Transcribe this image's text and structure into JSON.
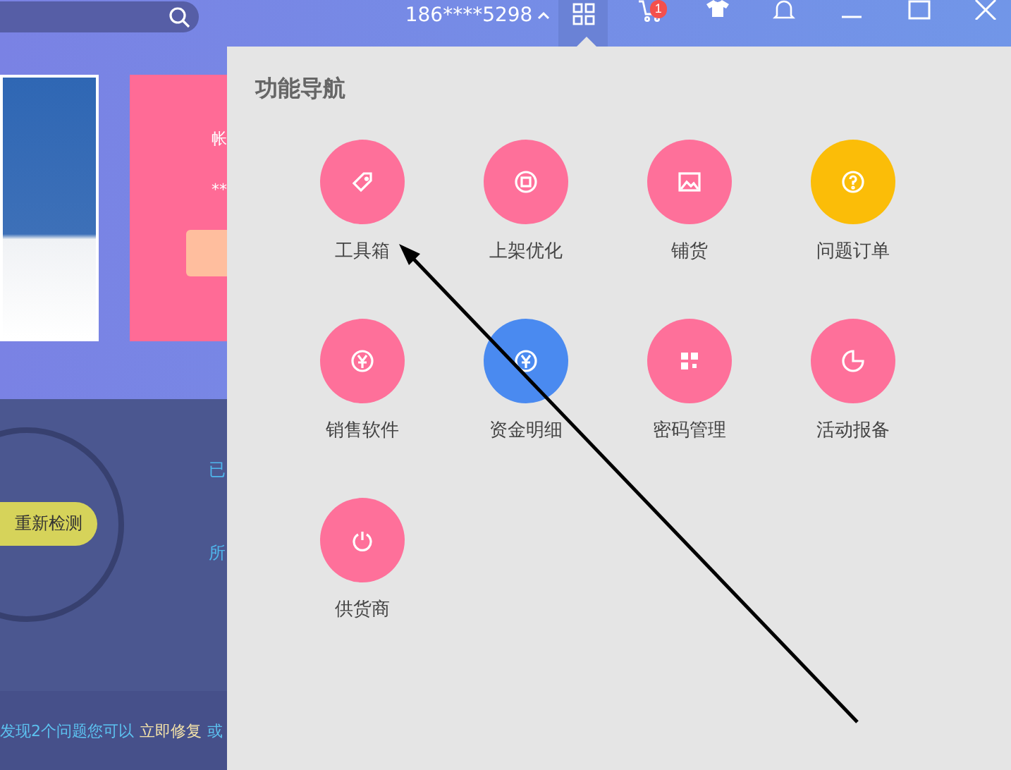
{
  "top_bar": {
    "account": "186****5298",
    "cart_badge": "1",
    "nav_selected": true
  },
  "promo_card": {
    "texts": [
      "帐",
      "**"
    ]
  },
  "scan_panel": {
    "button": "重新检测",
    "stats": [
      "已",
      "所"
    ],
    "message": "发现2个问题您可以",
    "fix_link": "立即修复",
    "tail": "或"
  },
  "nav_panel": {
    "title": "功能导航",
    "items": [
      {
        "label": "工具箱",
        "color": "#fe709a"
      },
      {
        "label": "上架优化",
        "color": "#fe709a"
      },
      {
        "label": "铺货",
        "color": "#fe709a"
      },
      {
        "label": "问题订单",
        "color": "#fbbd08"
      },
      {
        "label": "销售软件",
        "color": "#fe709a"
      },
      {
        "label": "资金明细",
        "color": "#4a8af0"
      },
      {
        "label": "密码管理",
        "color": "#fe709a"
      },
      {
        "label": "活动报备",
        "color": "#fe709a"
      },
      {
        "label": "供货商",
        "color": "#fe709a"
      }
    ]
  }
}
